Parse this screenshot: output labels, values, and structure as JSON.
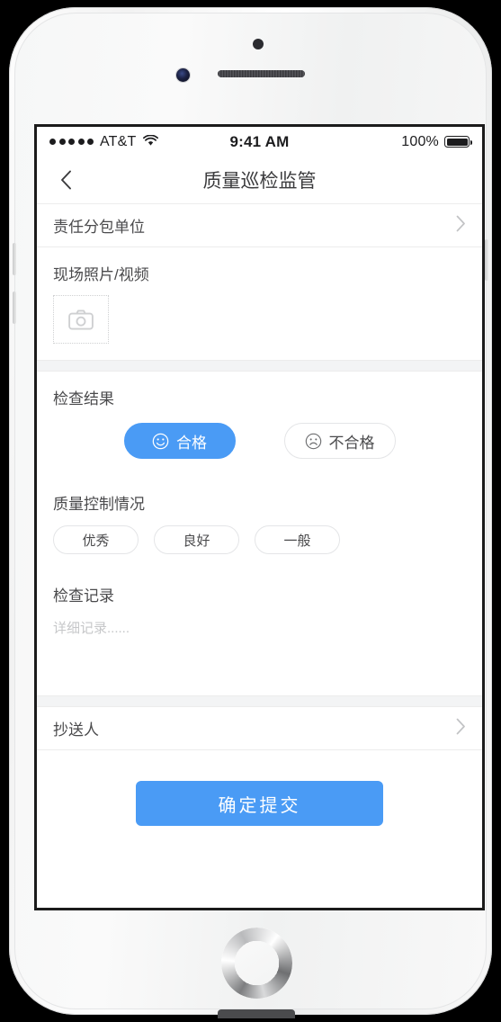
{
  "status_bar": {
    "signal_dots": 5,
    "carrier": "AT&T",
    "wifi_icon": "wifi-icon",
    "time": "9:41 AM",
    "battery_percent": "100%",
    "battery_icon": "battery-full-icon"
  },
  "nav": {
    "back_icon": "chevron-left-icon",
    "title": "质量巡检监管"
  },
  "form": {
    "subcontractor_row": {
      "label": "责任分包单位",
      "chevron_icon": "chevron-right-icon"
    },
    "media": {
      "label": "现场照片/视频",
      "upload_icon": "camera-icon"
    },
    "inspection_result": {
      "label": "检查结果",
      "options": [
        {
          "label": "合格",
          "icon": "smiley-face-icon",
          "selected": true
        },
        {
          "label": "不合格",
          "icon": "frowny-face-icon",
          "selected": false
        }
      ]
    },
    "quality_control": {
      "label": "质量控制情况",
      "options": [
        {
          "label": "优秀",
          "selected": false
        },
        {
          "label": "良好",
          "selected": false
        },
        {
          "label": "一般",
          "selected": false
        }
      ]
    },
    "record": {
      "label": "检查记录",
      "value": "",
      "placeholder": "详细记录......"
    },
    "cc_row": {
      "label": "抄送人",
      "chevron_icon": "chevron-right-icon"
    },
    "submit_label": "确定提交"
  },
  "colors": {
    "accent": "#4a9bf5",
    "text_primary": "#4a4a4c",
    "text_placeholder": "#c6c7c9",
    "divider": "#ececec",
    "section_gap": "#f3f4f5"
  }
}
